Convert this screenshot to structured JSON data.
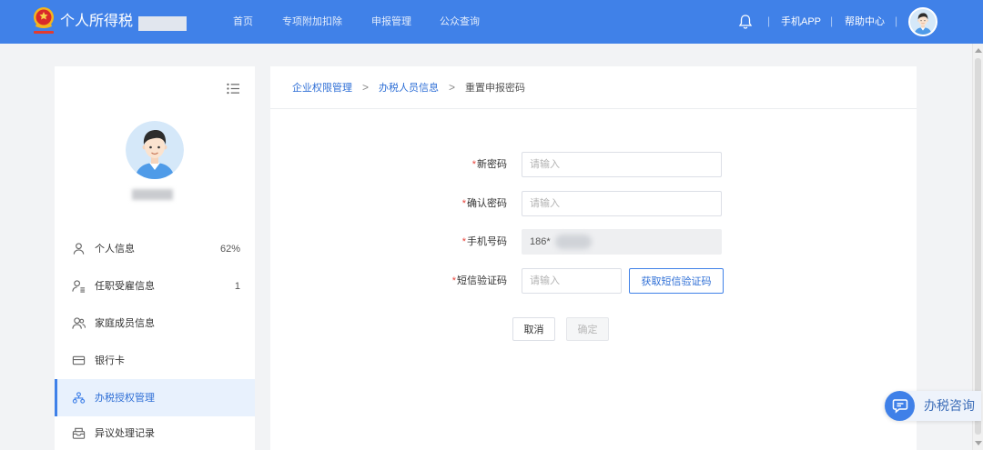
{
  "colors": {
    "header_bg": "#4081e8",
    "primary": "#3f80e8",
    "link": "#2f6fd6",
    "required": "#e8453c",
    "page_bg": "#f2f3f5",
    "active_bg": "#e8f1fd"
  },
  "header": {
    "app_title": "个人所得税",
    "nav": [
      {
        "label": "首页"
      },
      {
        "label": "专项附加扣除"
      },
      {
        "label": "申报管理"
      },
      {
        "label": "公众查询"
      }
    ],
    "notification_icon": "bell-icon",
    "mobile_app_label": "手机APP",
    "help_center_label": "帮助中心",
    "separator": "|"
  },
  "sidebar": {
    "toggle_icon": "menu-list-icon",
    "menu": [
      {
        "label": "个人信息",
        "value": "62%",
        "icon": "user-icon"
      },
      {
        "label": "任职受雇信息",
        "value": "1",
        "icon": "user-list-icon"
      },
      {
        "label": "家庭成员信息",
        "icon": "family-icon"
      },
      {
        "label": "银行卡",
        "icon": "bank-card-icon"
      },
      {
        "label": "办税授权管理",
        "icon": "authorization-icon",
        "active": true
      },
      {
        "label": "异议处理记录",
        "icon": "objection-record-icon"
      }
    ]
  },
  "breadcrumb": {
    "items": [
      {
        "label": "企业权限管理"
      },
      {
        "label": "办税人员信息"
      },
      {
        "label": "重置申报密码"
      }
    ],
    "separator": ">"
  },
  "form": {
    "required_mark": "*",
    "new_password": {
      "label": "新密码",
      "placeholder": "请输入"
    },
    "confirm_password": {
      "label": "确认密码",
      "placeholder": "请输入"
    },
    "phone": {
      "label": "手机号码",
      "value": "186*"
    },
    "sms_code": {
      "label": "短信验证码",
      "placeholder": "请输入"
    },
    "get_code_button": "获取短信验证码",
    "cancel_button": "取消",
    "confirm_button": "确定"
  },
  "float_consult": {
    "label": "办税咨询",
    "icon": "chat-icon"
  }
}
